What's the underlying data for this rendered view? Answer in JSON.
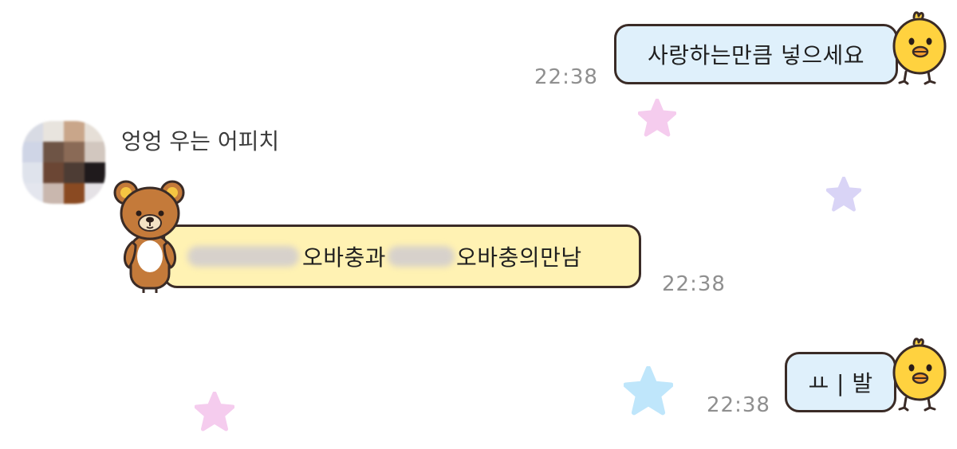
{
  "colors": {
    "sent_bubble_bg": "#dff0fb",
    "recv_bubble_bg": "#fff2b3",
    "bubble_border": "#3a2b26",
    "time_text": "#8f8f8f",
    "star_pink": "#f5ccee",
    "star_lavender": "#d9d4f6",
    "star_blue": "#bfe6fb"
  },
  "messages": [
    {
      "direction": "sent",
      "text": "사랑하는만큼 넣으세요",
      "time": "22:38",
      "sticker": "yellow-chick-icon"
    },
    {
      "direction": "received",
      "sender": "엉엉 우는 어피치",
      "avatar": "blurred-avatar",
      "sticker": "brown-bear-icon",
      "text_parts": [
        "오바충과",
        "오바충의만남"
      ],
      "redacted_parts": [
        "blurred-word-1",
        "blurred-word-2"
      ],
      "time": "22:38"
    },
    {
      "direction": "sent",
      "text": "ㅛ | 발",
      "time": "22:38",
      "sticker": "yellow-chick-icon"
    }
  ],
  "background_decorations": [
    "pink-star-icon",
    "lavender-star-icon",
    "blue-star-icon",
    "pink-star-icon"
  ]
}
